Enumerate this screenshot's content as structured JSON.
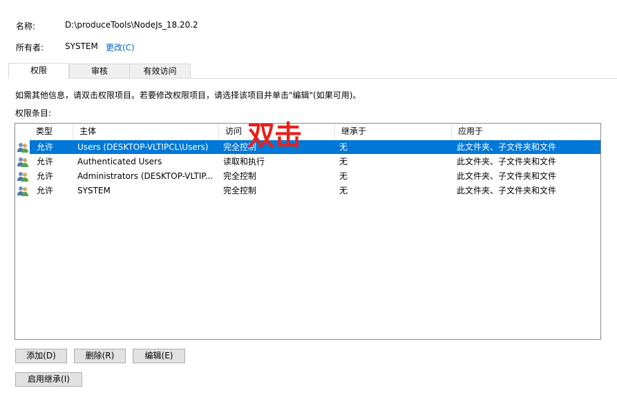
{
  "object": {
    "name_label": "名称:",
    "name_value": "D:\\produceTools\\NodeJs_18.20.2",
    "owner_label": "所有者:",
    "owner_value": "SYSTEM",
    "change_link": "更改(C)"
  },
  "tabs": [
    {
      "label": "权限",
      "active": true
    },
    {
      "label": "审核",
      "active": false
    },
    {
      "label": "有效访问",
      "active": false
    }
  ],
  "info_text": "如需其他信息，请双击权限项目。若要修改权限项目，请选择该项目并单击\"编辑\"(如果可用)。",
  "entries_label": "权限条目:",
  "table": {
    "columns": [
      "类型",
      "主体",
      "访问",
      "继承于",
      "应用于"
    ],
    "rows": [
      {
        "icon": "users-icon",
        "type": "允许",
        "principal": "Users (DESKTOP-VLTIPCL\\Users)",
        "access": "完全控制",
        "inherited": "无",
        "applies": "此文件夹、子文件夹和文件",
        "selected": true
      },
      {
        "icon": "users-icon",
        "type": "允许",
        "principal": "Authenticated Users",
        "access": "读取和执行",
        "inherited": "无",
        "applies": "此文件夹、子文件夹和文件",
        "selected": false
      },
      {
        "icon": "users-icon",
        "type": "允许",
        "principal": "Administrators (DESKTOP-VLTIP...",
        "access": "完全控制",
        "inherited": "无",
        "applies": "此文件夹、子文件夹和文件",
        "selected": false
      },
      {
        "icon": "users-icon",
        "type": "允许",
        "principal": "SYSTEM",
        "access": "完全控制",
        "inherited": "无",
        "applies": "此文件夹、子文件夹和文件",
        "selected": false
      }
    ]
  },
  "annotation": "双击",
  "buttons": {
    "add": "添加(D)",
    "remove": "删除(R)",
    "edit": "编辑(E)",
    "enable_inheritance": "启用继承(I)"
  },
  "colors": {
    "selection": "#0078d7",
    "link": "#0066cc",
    "annotation": "#e8201a"
  }
}
